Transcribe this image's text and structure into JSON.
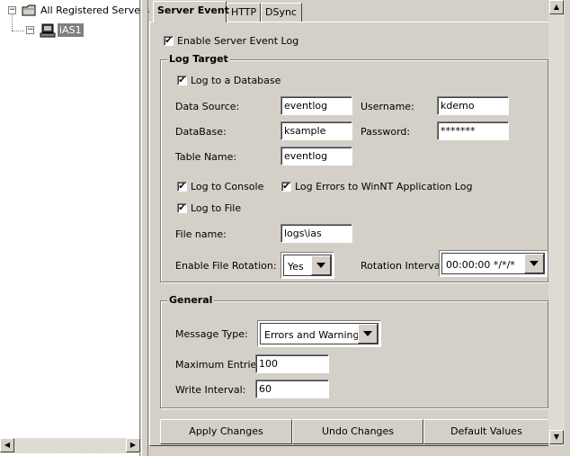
{
  "tree": {
    "root_label": "All Registered Servers",
    "child_label": "iAS1",
    "root_toggle": "−",
    "child_toggle": "−"
  },
  "tabs": [
    {
      "label": "Server Event",
      "active": true
    },
    {
      "label": "HTTP",
      "active": false
    },
    {
      "label": "DSync",
      "active": false
    }
  ],
  "enable_event_log": {
    "label": "Enable Server Event Log",
    "checked": true
  },
  "log_target": {
    "title": "Log Target",
    "log_to_database": {
      "label": "Log to a Database",
      "checked": true
    },
    "data_source": {
      "label": "Data Source:",
      "value": "eventlog"
    },
    "username": {
      "label": "Username:",
      "value": "kdemo"
    },
    "database": {
      "label": "DataBase:",
      "value": "ksample"
    },
    "password": {
      "label": "Password:",
      "value": "*******"
    },
    "table_name": {
      "label": "Table Name:",
      "value": "eventlog"
    },
    "log_to_console": {
      "label": "Log to Console",
      "checked": true
    },
    "log_errors_winnt": {
      "label": "Log Errors to WinNT Application Log",
      "checked": true
    },
    "log_to_file": {
      "label": "Log to File",
      "checked": true
    },
    "file_name": {
      "label": "File name:",
      "value": "logs\\ias"
    },
    "file_rotation": {
      "label": "Enable File Rotation:",
      "value": "Yes"
    },
    "rotation_interval": {
      "label": "Rotation Interval:",
      "value": "00:00:00 */*/*"
    }
  },
  "general": {
    "title": "General",
    "message_type": {
      "label": "Message Type:",
      "value": "Errors and Warnings"
    },
    "max_entries": {
      "label": "Maximum Entries:",
      "value": "100"
    },
    "write_interval": {
      "label": "Write Interval:",
      "value": "60"
    }
  },
  "buttons": {
    "apply": "Apply Changes",
    "undo": "Undo Changes",
    "defaults": "Default Values"
  },
  "icons": {
    "check": "✔",
    "scroll_left": "◀",
    "scroll_right": "▶",
    "scroll_up": "▲",
    "scroll_down": "▼"
  }
}
